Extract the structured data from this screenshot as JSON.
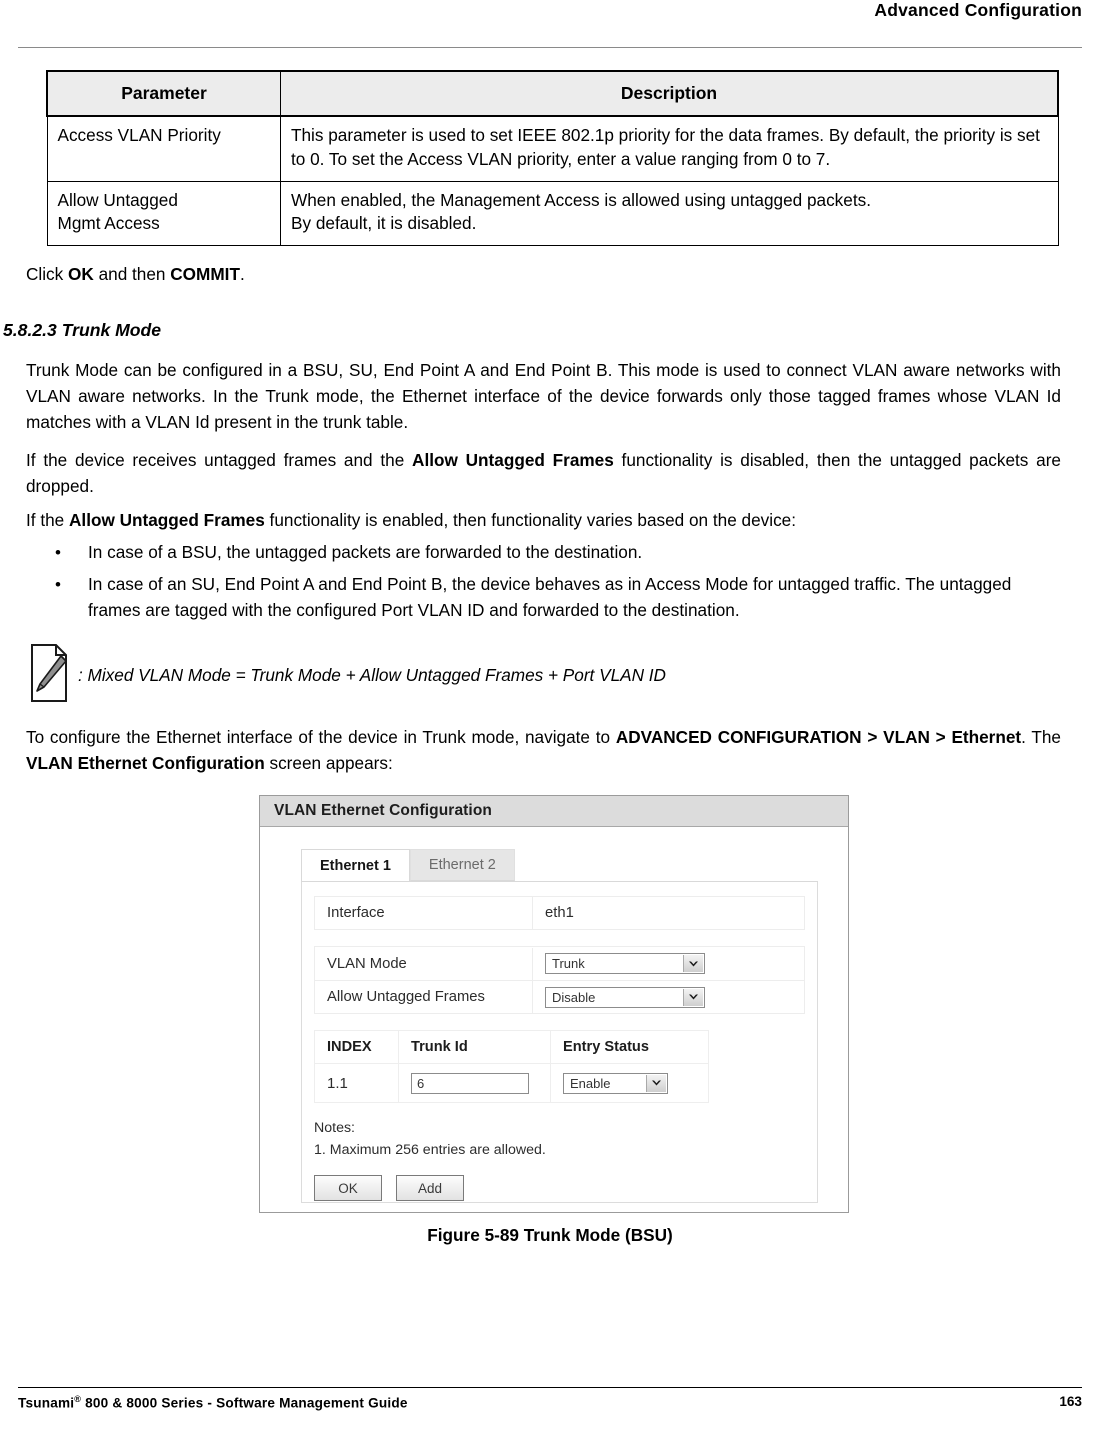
{
  "header": {
    "running_head": "Advanced Configuration"
  },
  "param_table": {
    "columns": [
      "Parameter",
      "Description"
    ],
    "rows": [
      {
        "parameter": "Access VLAN Priority",
        "description": "This parameter is used to set IEEE 802.1p priority for the data frames. By default, the priority is set to 0. To set the Access VLAN priority, enter a value ranging from 0 to 7."
      },
      {
        "parameter": "Allow Untagged Mgmt Access",
        "description_line1": "When enabled, the Management Access is allowed using untagged packets.",
        "description_line2": "By default, it is disabled."
      }
    ]
  },
  "body": {
    "click_line": {
      "pre": "Click ",
      "ok": "OK",
      "mid": " and then ",
      "commit": "COMMIT",
      "post": "."
    },
    "section_heading": "5.8.2.3 Trunk Mode",
    "para1": "Trunk Mode can be configured in a BSU, SU, End Point A and End Point B. This mode is used to connect VLAN aware networks with VLAN aware networks. In the Trunk mode, the Ethernet interface of the device forwards only those tagged frames whose VLAN Id matches with a VLAN Id present in the trunk table.",
    "para2": {
      "pre": "If the device receives untagged frames and the ",
      "bold": "Allow Untagged Frames",
      "post": " functionality is disabled, then the untagged packets are dropped."
    },
    "para3": {
      "pre": "If the ",
      "bold": "Allow Untagged Frames",
      "post": " functionality is enabled, then functionality varies based on the device:"
    },
    "bullets": [
      "In case of a BSU, the untagged packets are forwarded to the destination.",
      "In case of an SU, End Point A and End Point B, the device behaves as in Access Mode for untagged traffic. The untagged frames are tagged with the configured Port VLAN ID and forwarded to the destination."
    ],
    "note": {
      "icon": "note-pencil-icon",
      "text": ": Mixed VLAN Mode = Trunk Mode + Allow Untagged Frames + Port VLAN ID"
    },
    "para4": {
      "pre": "To configure the Ethernet interface of the device in Trunk mode, navigate to ",
      "bold1": "ADVANCED CONFIGURATION > VLAN > Ethernet",
      "mid": ". The ",
      "bold2": "VLAN Ethernet Configuration",
      "post": " screen appears:"
    }
  },
  "screenshot": {
    "window_title": "VLAN Ethernet Configuration",
    "tabs": [
      {
        "label": "Ethernet 1",
        "active": true
      },
      {
        "label": "Ethernet 2",
        "active": false
      }
    ],
    "fields": [
      {
        "label": "Interface",
        "value": "eth1",
        "type": "text-readonly"
      },
      {
        "label": "VLAN Mode",
        "value": "Trunk",
        "type": "select"
      },
      {
        "label": "Allow Untagged Frames",
        "value": "Disable",
        "type": "select"
      }
    ],
    "grid": {
      "columns": [
        "INDEX",
        "Trunk Id",
        "Entry Status"
      ],
      "rows": [
        {
          "index": "1.1",
          "trunk_id": "6",
          "entry_status": "Enable"
        }
      ]
    },
    "notes_label": "Notes:",
    "notes_item": "1. Maximum 256 entries are allowed.",
    "buttons": [
      {
        "label": "OK"
      },
      {
        "label": "Add"
      }
    ]
  },
  "figure_caption": "Figure 5-89 Trunk Mode (BSU)",
  "footer": {
    "left_pre": "Tsunami",
    "left_sup": "®",
    "left_post": " 800 & 8000 Series - Software Management Guide",
    "page_number": "163"
  }
}
